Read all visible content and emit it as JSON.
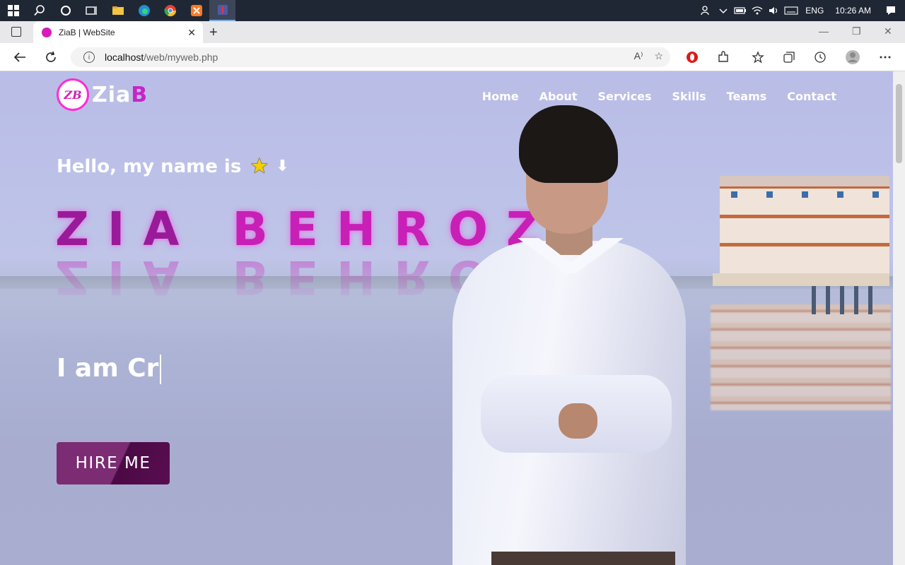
{
  "taskbar": {
    "tray_lang": "ENG",
    "tray_time": "10:26 AM"
  },
  "browser": {
    "tab_title": "ZiaB | WebSite",
    "url_host": "localhost",
    "url_path": "/web/myweb.php"
  },
  "page": {
    "logo_text_main": "Zia",
    "logo_text_accent": "B",
    "logo_badge": "ZB",
    "nav": [
      "Home",
      "About",
      "Services",
      "Skills",
      "Teams",
      "Contact"
    ],
    "greeting": "Hello, my name is",
    "name_first": "ZIA",
    "name_last": "BEHROZ",
    "typed_text": "I am Cr",
    "hire_button": "HIRE ME"
  },
  "colors": {
    "accent": "#c81fb7",
    "button_bg": "#7b2c73",
    "taskbar_bg": "#202734"
  }
}
